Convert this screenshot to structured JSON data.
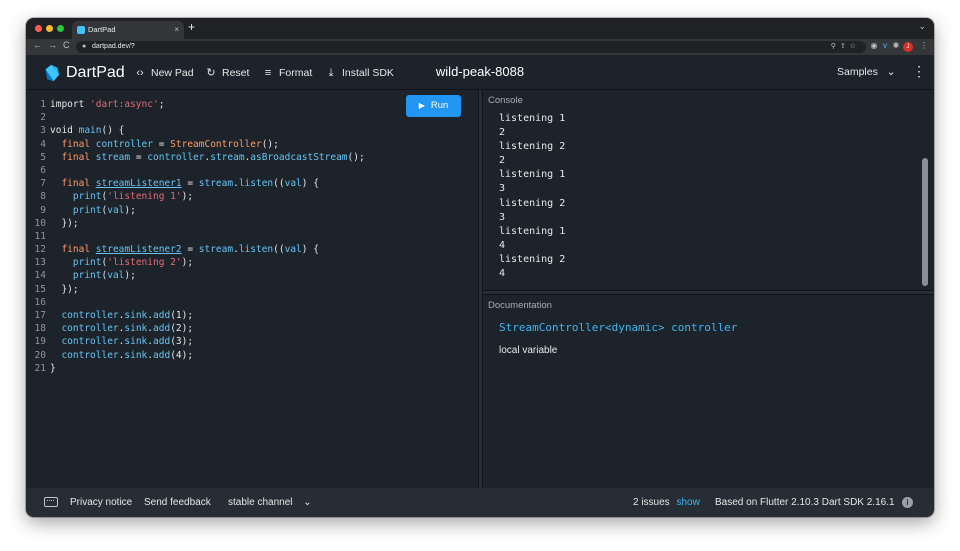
{
  "browser": {
    "tab_title": "DartPad",
    "tab_close": "×",
    "new_tab": "+",
    "tabs_menu": "⌄",
    "back": "←",
    "forward": "→",
    "reload": "C",
    "url": "dartpad.dev/?",
    "profile_initial": "J"
  },
  "header": {
    "app_name": "DartPad",
    "new_pad": "New Pad",
    "reset": "Reset",
    "format": "Format",
    "install_sdk": "Install SDK",
    "pad_name": "wild-peak-8088",
    "samples": "Samples",
    "icons": {
      "new_pad": "‹›",
      "reset": "↻",
      "format": "≡",
      "install_sdk": "⤓",
      "samples_caret": "⌄",
      "more": "⋮"
    }
  },
  "editor": {
    "run_label": "Run",
    "line_numbers": [
      "1",
      "2",
      "3",
      "4",
      "5",
      "6",
      "7",
      "8",
      "9",
      "10",
      "11",
      "12",
      "13",
      "14",
      "15",
      "16",
      "17",
      "18",
      "19",
      "20",
      "21"
    ]
  },
  "console": {
    "label": "Console",
    "lines": [
      "listening 1",
      "2",
      "listening 2",
      "2",
      "listening 1",
      "3",
      "listening 2",
      "3",
      "listening 1",
      "4",
      "listening 2",
      "4"
    ]
  },
  "documentation": {
    "label": "Documentation",
    "signature": "StreamController<dynamic> controller",
    "description": "local variable"
  },
  "footer": {
    "privacy": "Privacy notice",
    "feedback": "Send feedback",
    "channel": "stable channel",
    "channel_caret": "⌄",
    "issues_count": "2 issues",
    "issues_show": "show",
    "sdk_info": "Based on Flutter 2.10.3 Dart SDK 2.16.1",
    "info": "i"
  },
  "colors": {
    "accent": "#2196f3",
    "background": "#1c232b",
    "footer": "#272d34",
    "string": "#e06c75",
    "type": "#ff9966",
    "identifier": "#67c3f0"
  }
}
